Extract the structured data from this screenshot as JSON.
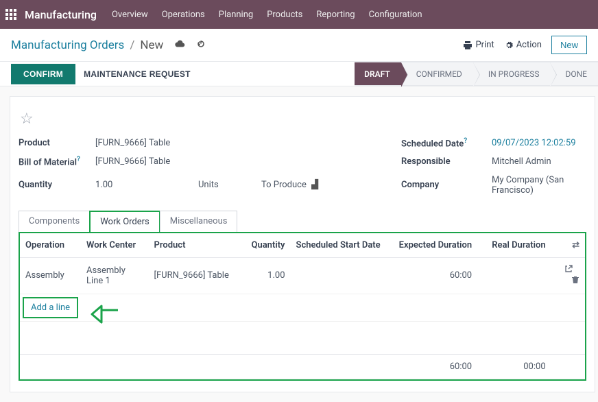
{
  "app": {
    "title": "Manufacturing"
  },
  "nav": {
    "items": [
      "Overview",
      "Operations",
      "Planning",
      "Products",
      "Reporting",
      "Configuration"
    ]
  },
  "breadcrumb": {
    "parent": "Manufacturing Orders",
    "current": "New"
  },
  "toolbar": {
    "print": "Print",
    "action": "Action",
    "new": "New",
    "confirm": "CONFIRM",
    "maintenance": "MAINTENANCE REQUEST"
  },
  "stages": {
    "items": [
      "DRAFT",
      "CONFIRMED",
      "IN PROGRESS",
      "DONE"
    ],
    "active": 0
  },
  "form": {
    "product_label": "Product",
    "product_value": "[FURN_9666] Table",
    "bom_label": "Bill of Material",
    "bom_value": "[FURN_9666] Table",
    "quantity_label": "Quantity",
    "quantity_value": "1.00",
    "quantity_unit": "Units",
    "to_produce_label": "To Produce",
    "scheduled_label": "Scheduled Date",
    "scheduled_value": "09/07/2023 12:02:59",
    "responsible_label": "Responsible",
    "responsible_value": "Mitchell Admin",
    "company_label": "Company",
    "company_value": "My Company (San Francisco)"
  },
  "tabs": {
    "components": "Components",
    "work_orders": "Work Orders",
    "misc": "Miscellaneous"
  },
  "table": {
    "headers": {
      "operation": "Operation",
      "work_center": "Work Center",
      "product": "Product",
      "quantity": "Quantity",
      "scheduled": "Scheduled Start Date",
      "expected": "Expected Duration",
      "real": "Real Duration"
    },
    "rows": [
      {
        "operation": "Assembly",
        "work_center": "Assembly Line 1",
        "product": "[FURN_9666] Table",
        "quantity": "1.00",
        "scheduled": "",
        "expected": "60:00",
        "real": ""
      }
    ],
    "add_line": "Add a line",
    "totals": {
      "expected": "60:00",
      "real": "00:00"
    }
  }
}
